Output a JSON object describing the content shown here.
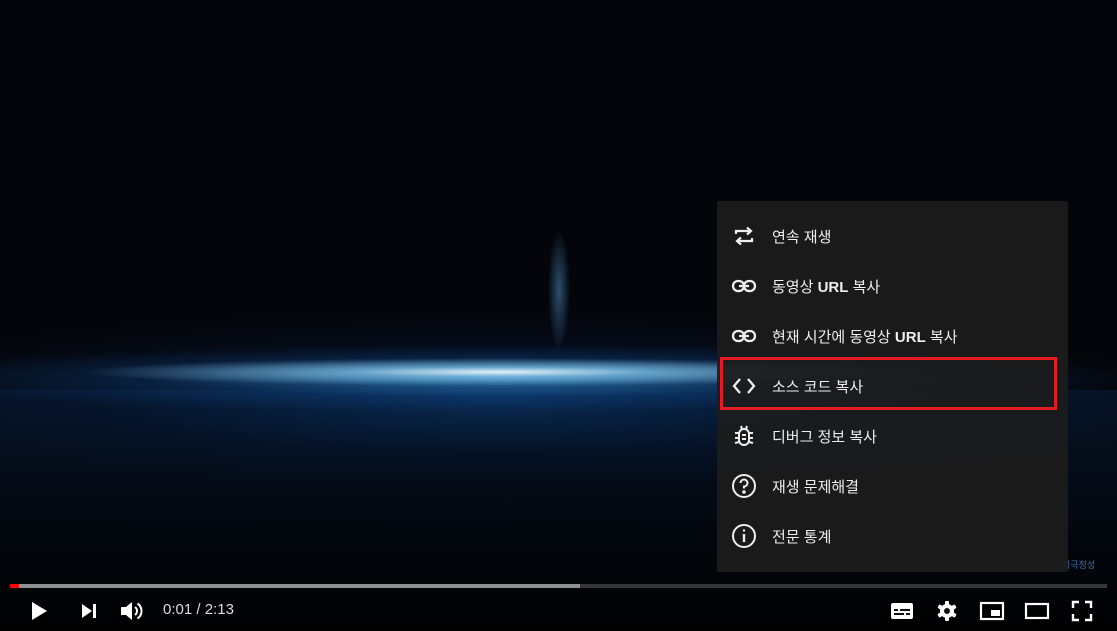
{
  "context_menu": {
    "items": [
      {
        "label": "연속 재생",
        "icon": "loop-icon"
      },
      {
        "label_pre": "동영상 ",
        "label_bold": "URL",
        "label_post": " 복사",
        "icon": "link-icon"
      },
      {
        "label_pre": "현재 시간에 동영상 ",
        "label_bold": "URL",
        "label_post": " 복사",
        "icon": "link-icon"
      },
      {
        "label": "소스 코드 복사",
        "icon": "code-icon"
      },
      {
        "label": "디버그 정보 복사",
        "icon": "bug-icon"
      },
      {
        "label": "재생 문제해결",
        "icon": "help-circle-icon"
      },
      {
        "label": "전문 통계",
        "icon": "info-circle-icon"
      }
    ],
    "highlighted_index": 3,
    "highlight_color": "#e51b24"
  },
  "player": {
    "current_time": "0:01",
    "separator": " / ",
    "duration": "2:13",
    "played_fraction": 0.008,
    "buffered_fraction": 0.52,
    "progress_color": "#ff0000"
  },
  "watermark": "지극정성"
}
